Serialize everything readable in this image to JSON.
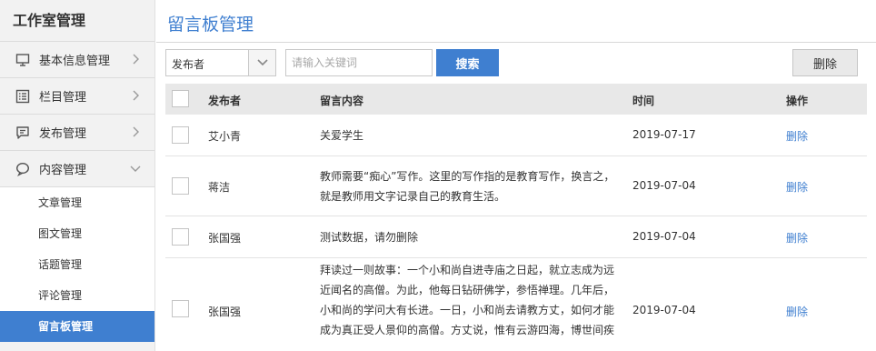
{
  "sidebar": {
    "title": "工作室管理",
    "items": [
      {
        "label": "基本信息管理",
        "icon": "monitor-icon"
      },
      {
        "label": "栏目管理",
        "icon": "list-icon"
      },
      {
        "label": "发布管理",
        "icon": "message-icon"
      },
      {
        "label": "内容管理",
        "icon": "chat-bubble-icon"
      }
    ],
    "sub_items": [
      {
        "label": "文章管理"
      },
      {
        "label": "图文管理"
      },
      {
        "label": "话题管理"
      },
      {
        "label": "评论管理"
      },
      {
        "label": "留言板管理",
        "active": true
      }
    ]
  },
  "main": {
    "title": "留言板管理",
    "filter": {
      "select_value": "发布者",
      "search_placeholder": "请输入关键词",
      "search_label": "搜索",
      "delete_label": "删除"
    },
    "table": {
      "headers": {
        "publisher": "发布者",
        "content": "留言内容",
        "time": "时间",
        "action": "操作"
      },
      "rows": [
        {
          "publisher": "艾小青",
          "content": "关爱学生",
          "time": "2019-07-17",
          "action": "删除"
        },
        {
          "publisher": "蒋洁",
          "content": "教师需要“痴心”写作。这里的写作指的是教育写作，换言之，就是教师用文字记录自己的教育生活。",
          "time": "2019-07-04",
          "action": "删除"
        },
        {
          "publisher": "张国强",
          "content": "测试数据，请勿删除",
          "time": "2019-07-04",
          "action": "删除"
        },
        {
          "publisher": "张国强",
          "content": "拜读过一则故事：一个小和尚自进寺庙之日起，就立志成为远近闻名的高僧。为此，他每日钻研佛学，参悟禅理。几年后，小和尚的学问大有长进。一日，小和尚去请教方丈，如何才能成为真正受人景仰的高僧。方丈说，惟有云游四海，博世间疾",
          "time": "2019-07-04",
          "action": "删除"
        }
      ]
    }
  },
  "colors": {
    "accent": "#3f7fd0",
    "sidebar_bg": "#f2f2f2",
    "header_bg": "#e8e8e8"
  }
}
